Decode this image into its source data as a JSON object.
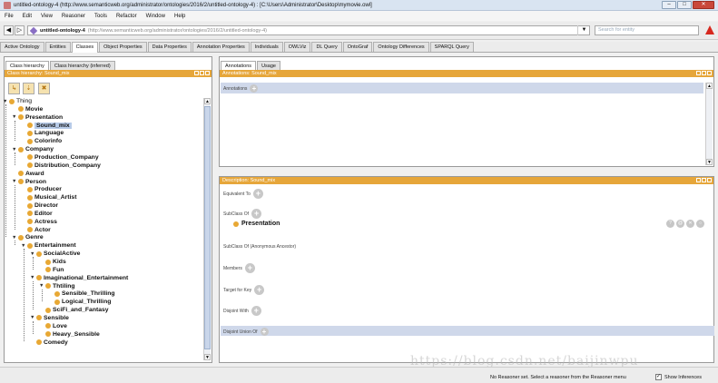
{
  "window": {
    "title": "untitled-ontology-4 (http://www.semanticweb.org/administrator/ontologies/2016/2/untitled-ontology-4) : [C:\\Users\\Administrator\\Desktop\\mymovie.owl]",
    "min": "–",
    "max": "□",
    "close": "✕"
  },
  "menu": [
    "File",
    "Edit",
    "View",
    "Reasoner",
    "Tools",
    "Refactor",
    "Window",
    "Help"
  ],
  "address": {
    "back": "◀",
    "forward": "▷",
    "ontology_name": "untitled-ontology-4",
    "ontology_iri": "(http://www.semanticweb.org/administrator/ontologies/2016/2/untitled-ontology-4)",
    "dropdown": "▼",
    "search_placeholder": "Search for entity"
  },
  "tabs": [
    "Active Ontology",
    "Entities",
    "Classes",
    "Object Properties",
    "Data Properties",
    "Annotation Properties",
    "Individuals",
    "OWLViz",
    "DL Query",
    "OntoGraf",
    "Ontology Differences",
    "SPARQL Query"
  ],
  "left": {
    "subtabs": [
      "Class hierarchy",
      "Class hierarchy (inferred)"
    ],
    "header": "Class hierarchy: Sound_mix",
    "tools": [
      "↳",
      "⇣",
      "✖"
    ],
    "tree": [
      {
        "label": "Thing",
        "depth": 0,
        "open": true,
        "root": true
      },
      {
        "label": "Movie",
        "depth": 1
      },
      {
        "label": "Presentation",
        "depth": 1,
        "open": true
      },
      {
        "label": "Sound_mix",
        "depth": 2,
        "selected": true
      },
      {
        "label": "Language",
        "depth": 2
      },
      {
        "label": "Colorinfo",
        "depth": 2
      },
      {
        "label": "Company",
        "depth": 1,
        "open": true
      },
      {
        "label": "Production_Company",
        "depth": 2
      },
      {
        "label": "Distribution_Company",
        "depth": 2
      },
      {
        "label": "Award",
        "depth": 1
      },
      {
        "label": "Person",
        "depth": 1,
        "open": true
      },
      {
        "label": "Producer",
        "depth": 2
      },
      {
        "label": "Musical_Artist",
        "depth": 2
      },
      {
        "label": "Director",
        "depth": 2
      },
      {
        "label": "Editor",
        "depth": 2
      },
      {
        "label": "Actress",
        "depth": 2
      },
      {
        "label": "Actor",
        "depth": 2
      },
      {
        "label": "Genre",
        "depth": 1,
        "open": true
      },
      {
        "label": "Entertainment",
        "depth": 2,
        "open": true
      },
      {
        "label": "SocialActive",
        "depth": 3,
        "open": true
      },
      {
        "label": "Kids",
        "depth": 4
      },
      {
        "label": "Fun",
        "depth": 4
      },
      {
        "label": "Imaginational_Entertainment",
        "depth": 3,
        "open": true
      },
      {
        "label": "Thtiling",
        "depth": 4,
        "open": true
      },
      {
        "label": "Sensible_Thrilling",
        "depth": 5
      },
      {
        "label": "Logical_Thrilling",
        "depth": 5
      },
      {
        "label": "SciFi_and_Fantasy",
        "depth": 4
      },
      {
        "label": "Sensible",
        "depth": 3,
        "open": true
      },
      {
        "label": "Love",
        "depth": 4
      },
      {
        "label": "Heavy_Sensible",
        "depth": 4
      },
      {
        "label": "Comedy",
        "depth": 3
      }
    ]
  },
  "annotations": {
    "subtabs": [
      "Annotations",
      "Usage"
    ],
    "header": "Annotations: Sound_mix",
    "label": "Annotations"
  },
  "description": {
    "header": "Description: Sound_mix",
    "equivalent_to": "Equivalent To",
    "subclass_of": "SubClass Of",
    "subclass_value": "Presentation",
    "subclass_anon": "SubClass Of (Anonymous Ancestor)",
    "members": "Members",
    "target_for_key": "Target for Key",
    "disjoint_with": "Disjoint With",
    "disjoint_union_of": "Disjoint Union Of",
    "row_buttons": [
      "?",
      "@",
      "✕",
      "○"
    ]
  },
  "status": {
    "text": "No Reasoner set. Select a reasoner from the Reasoner menu",
    "checkbox": "✓",
    "show_inferences": "Show Inferences",
    "watermark": "https://blog.csdn.net/baijinwpu"
  },
  "colors": {
    "header": "#e6a63a",
    "class_dot": "#e8a834",
    "band": "#cfd8ea"
  }
}
